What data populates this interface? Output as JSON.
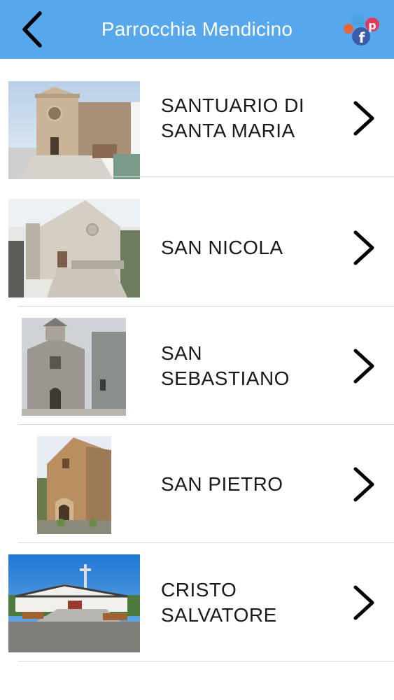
{
  "header": {
    "title": "Parrocchia Mendicino",
    "back_icon": "chevron-left-icon",
    "social_icon": "social-share-icon",
    "background_color": "#56a7ec"
  },
  "churches": [
    {
      "name": "SANTUARIO DI SANTA MARIA",
      "image": "church-photo"
    },
    {
      "name": "SAN NICOLA",
      "image": "church-photo"
    },
    {
      "name": "SAN SEBASTIANO",
      "image": "church-photo"
    },
    {
      "name": "SAN PIETRO",
      "image": "church-photo"
    },
    {
      "name": "CRISTO SALVATORE",
      "image": "church-photo"
    }
  ]
}
